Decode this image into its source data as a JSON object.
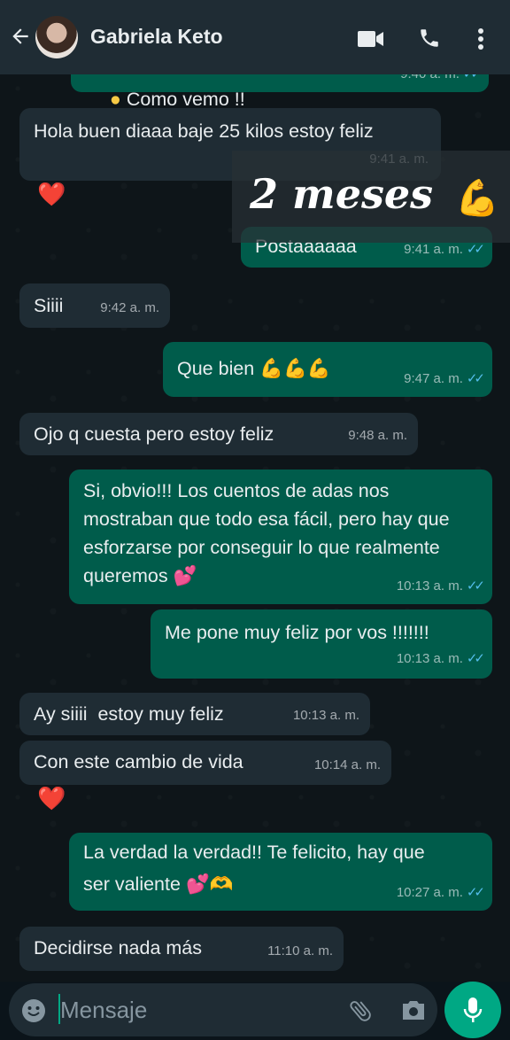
{
  "header": {
    "contact_name": "Gabriela Keto",
    "icons": [
      "back-arrow-icon",
      "video-call-icon",
      "phone-icon",
      "more-vert-icon"
    ]
  },
  "overlay": {
    "text": "2 meses",
    "emoji": "💪"
  },
  "messages": [
    {
      "dir": "out",
      "text": "Como vemo !!",
      "time": "9:40 a. m.",
      "read": true
    },
    {
      "dir": "in",
      "text": "Hola buen diaaa baje 25 kilos estoy feliz",
      "time": "9:41 a. m.",
      "reaction": "❤️"
    },
    {
      "dir": "out",
      "text": "Postaaaaaa",
      "time": "9:41 a. m.",
      "read": true
    },
    {
      "dir": "in",
      "text": "Siiii",
      "time": "9:42 a. m."
    },
    {
      "dir": "out",
      "text": "Que bien",
      "emoji": "💪💪💪",
      "time": "9:47 a. m.",
      "read": true
    },
    {
      "dir": "in",
      "text": "Ojo q cuesta pero estoy feliz",
      "time": "9:48 a. m."
    },
    {
      "dir": "out",
      "text": "Si, obvio!!! Los cuentos de adas nos mostraban que todo esa fácil, pero hay que esforzarse por conseguir lo que realmente queremos",
      "emoji": "💕",
      "time": "10:13 a. m.",
      "read": true
    },
    {
      "dir": "out",
      "text": "Me pone muy feliz por vos !!!!!!!",
      "time": "10:13 a. m.",
      "read": true
    },
    {
      "dir": "in",
      "text": "Ay siiii  estoy muy feliz",
      "time": "10:13 a. m."
    },
    {
      "dir": "in",
      "text": "Con este cambio de vida",
      "time": "10:14 a. m.",
      "reaction": "❤️"
    },
    {
      "dir": "out",
      "text": "La verdad la verdad!! Te felicito, hay que ser valiente",
      "emoji": "💕🫶",
      "time": "10:27 a. m.",
      "read": true
    },
    {
      "dir": "in",
      "text": "Decidirse nada más",
      "time": "11:10 a. m."
    }
  ],
  "composer": {
    "placeholder": "Mensaje"
  },
  "ticks": "✓✓",
  "colors": {
    "header": "#1f2c34",
    "incoming": "#1f2c34",
    "outgoing": "#005c4b",
    "accent": "#00a884",
    "read_ticks": "#53bdeb"
  }
}
